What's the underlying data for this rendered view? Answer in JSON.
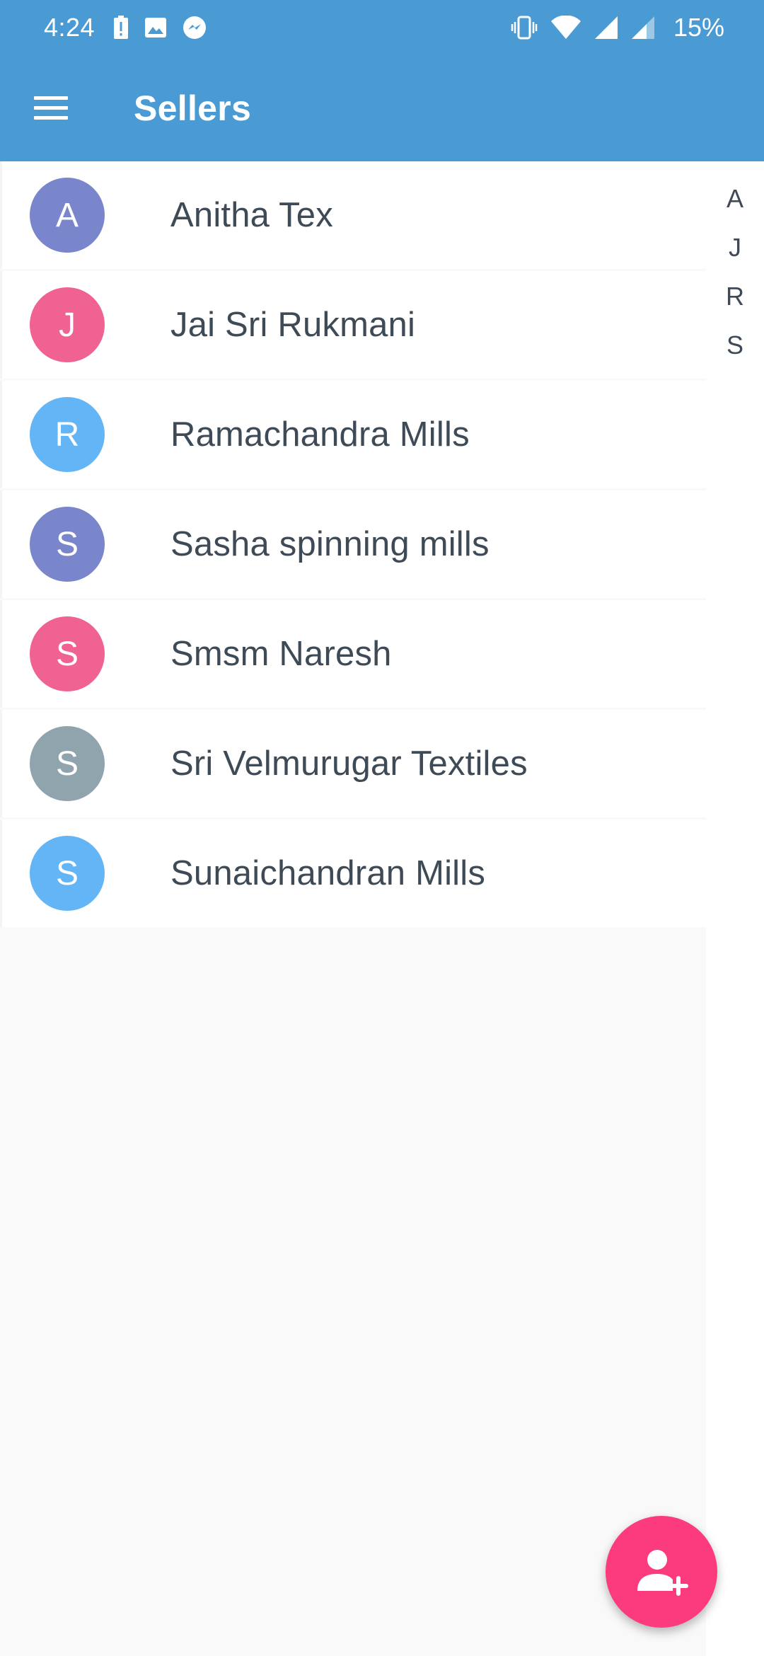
{
  "status_bar": {
    "time": "4:24",
    "battery_percent": "15%",
    "left_icons": [
      "battery-alert-icon",
      "image-icon",
      "messenger-icon"
    ],
    "right_icons": [
      "vibrate-icon",
      "wifi-icon",
      "signal-icon",
      "signal-icon"
    ]
  },
  "app_bar": {
    "title": "Sellers",
    "menu_icon": "menu-icon"
  },
  "sellers": [
    {
      "initial": "A",
      "name": "Anitha Tex",
      "color": "#7986cb"
    },
    {
      "initial": "J",
      "name": "Jai Sri Rukmani",
      "color": "#f06292"
    },
    {
      "initial": "R",
      "name": "Ramachandra Mills",
      "color": "#64b5f6"
    },
    {
      "initial": "S",
      "name": "Sasha spinning mills",
      "color": "#7986cb"
    },
    {
      "initial": "S",
      "name": "Smsm Naresh",
      "color": "#f06292"
    },
    {
      "initial": "S",
      "name": "Sri Velmurugar Textiles",
      "color": "#90a4ae"
    },
    {
      "initial": "S",
      "name": "Sunaichandran Mills",
      "color": "#64b5f6"
    }
  ],
  "index_letters": [
    "A",
    "J",
    "R",
    "S"
  ],
  "fab": {
    "icon": "add-user-icon",
    "color": "#fb3b7e"
  },
  "colors": {
    "primary": "#4a9bd4",
    "text": "#3e4a56",
    "background": "#f9f9f9"
  }
}
